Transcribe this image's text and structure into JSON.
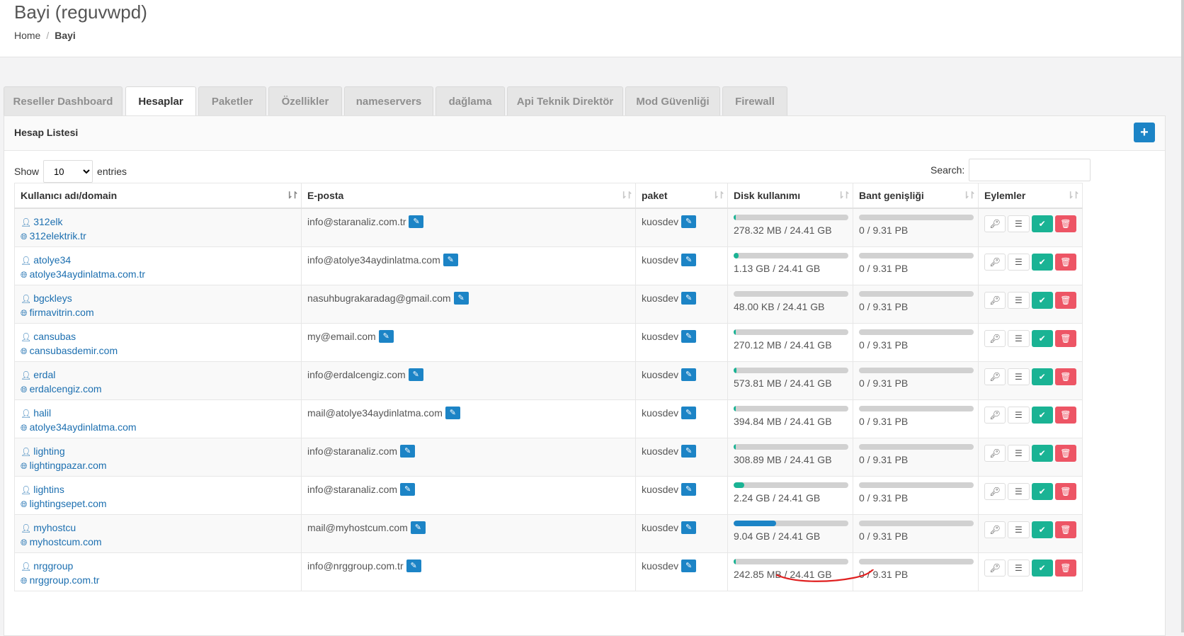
{
  "header": {
    "title": "Bayi (reguvwpd)",
    "breadcrumb": {
      "home": "Home",
      "separator": "/",
      "current": "Bayi"
    }
  },
  "tabs": [
    {
      "label": "Reseller Dashboard",
      "active": false
    },
    {
      "label": "Hesaplar",
      "active": true
    },
    {
      "label": "Paketler",
      "active": false
    },
    {
      "label": "Özellikler",
      "active": false
    },
    {
      "label": "nameservers",
      "active": false
    },
    {
      "label": "dağlama",
      "active": false
    },
    {
      "label": "Api Teknik Direktör",
      "active": false
    },
    {
      "label": "Mod Güvenliği",
      "active": false
    },
    {
      "label": "Firewall",
      "active": false
    }
  ],
  "panel": {
    "title": "Hesap Listesi",
    "add_icon": "plus-icon",
    "show_label": "Show",
    "entries_label": "entries",
    "page_length": "10",
    "search_label": "Search:",
    "search_value": ""
  },
  "table": {
    "columns": [
      "Kullanıcı adı/domain",
      "E-posta",
      "paket",
      "Disk kullanımı",
      "Bant genişliği",
      "Eylemler"
    ],
    "rows": [
      {
        "user": "312elk",
        "domain": "312elektrik.tr",
        "email": "info@staranaliz.com.tr",
        "package": "kuosdev",
        "disk": "278.32 MB / 24.41 GB",
        "disk_pct": 1.1,
        "bw": "0 / 9.31 PB",
        "bw_pct": 0
      },
      {
        "user": "atolye34",
        "domain": "atolye34aydinlatma.com.tr",
        "email": "info@atolye34aydinlatma.com",
        "package": "kuosdev",
        "disk": "1.13 GB / 24.41 GB",
        "disk_pct": 4.6,
        "bw": "0 / 9.31 PB",
        "bw_pct": 0
      },
      {
        "user": "bgckleys",
        "domain": "firmavitrin.com",
        "email": "nasuhbugrakaradag@gmail.com",
        "package": "kuosdev",
        "disk": "48.00 KB / 24.41 GB",
        "disk_pct": 0,
        "bw": "0 / 9.31 PB",
        "bw_pct": 0
      },
      {
        "user": "cansubas",
        "domain": "cansubasdemir.com",
        "email": "my@email.com",
        "package": "kuosdev",
        "disk": "270.12 MB / 24.41 GB",
        "disk_pct": 1.1,
        "bw": "0 / 9.31 PB",
        "bw_pct": 0
      },
      {
        "user": "erdal",
        "domain": "erdalcengiz.com",
        "email": "info@erdalcengiz.com",
        "package": "kuosdev",
        "disk": "573.81 MB / 24.41 GB",
        "disk_pct": 2.3,
        "bw": "0 / 9.31 PB",
        "bw_pct": 0
      },
      {
        "user": "halil",
        "domain": "atolye34aydinlatma.com",
        "email": "mail@atolye34aydinlatma.com",
        "package": "kuosdev",
        "disk": "394.84 MB / 24.41 GB",
        "disk_pct": 1.6,
        "bw": "0 / 9.31 PB",
        "bw_pct": 0
      },
      {
        "user": "lighting",
        "domain": "lightingpazar.com",
        "email": "info@staranaliz.com",
        "package": "kuosdev",
        "disk": "308.89 MB / 24.41 GB",
        "disk_pct": 1.3,
        "bw": "0 / 9.31 PB",
        "bw_pct": 0
      },
      {
        "user": "lightins",
        "domain": "lightingsepet.com",
        "email": "info@staranaliz.com",
        "package": "kuosdev",
        "disk": "2.24 GB / 24.41 GB",
        "disk_pct": 9.2,
        "bw": "0 / 9.31 PB",
        "bw_pct": 0
      },
      {
        "user": "myhostcu",
        "domain": "myhostcum.com",
        "email": "mail@myhostcum.com",
        "package": "kuosdev",
        "disk": "9.04 GB / 24.41 GB",
        "disk_pct": 37,
        "bw": "0 / 9.31 PB",
        "bw_pct": 0
      },
      {
        "user": "nrggroup",
        "domain": "nrggroup.com.tr",
        "email": "info@nrggroup.com.tr",
        "package": "kuosdev",
        "disk": "242.85 MB / 24.41 GB",
        "disk_pct": 1.0,
        "bw": "0 / 9.31 PB",
        "bw_pct": 0
      }
    ],
    "row_icons": {
      "user": "user-icon",
      "domain": "globe-icon",
      "edit": "edit-icon"
    },
    "action_icons": [
      "key-icon",
      "database-icon",
      "check-icon",
      "trash-icon"
    ]
  },
  "colors": {
    "primary": "#1c84c6",
    "success": "#1ab394",
    "danger": "#ed5565",
    "disk_low": "#1ab394",
    "disk_high": "#1c84c6",
    "annotation": "#e02020"
  }
}
